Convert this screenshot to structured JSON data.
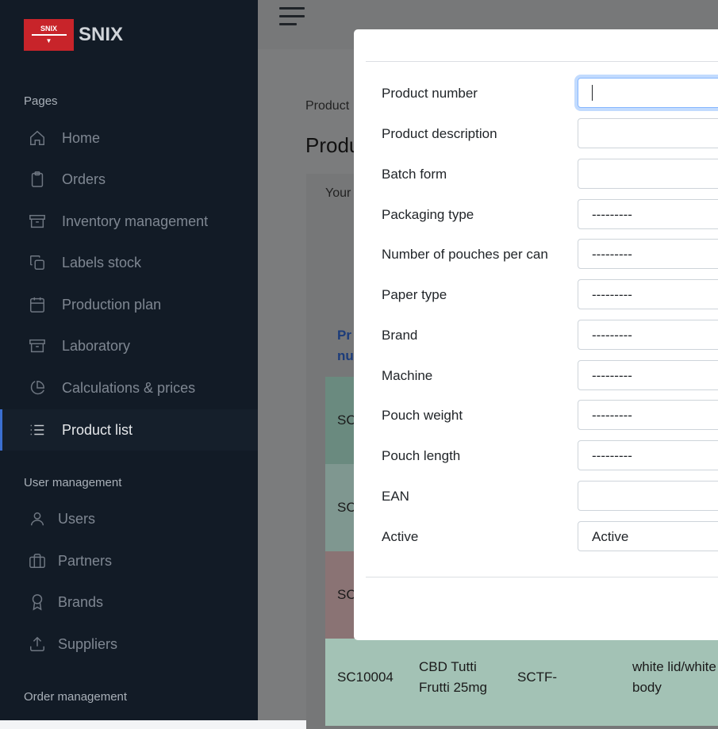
{
  "brand": {
    "logo_text": "SNIX",
    "name": "SNIX"
  },
  "sidebar": {
    "section_pages": "Pages",
    "pages": [
      {
        "label": "Home",
        "icon": "home-icon"
      },
      {
        "label": "Orders",
        "icon": "clipboard-icon"
      },
      {
        "label": "Inventory management",
        "icon": "archive-icon"
      },
      {
        "label": "Labels stock",
        "icon": "copy-icon"
      },
      {
        "label": "Production plan",
        "icon": "calendar-icon"
      },
      {
        "label": "Laboratory",
        "icon": "archive-icon"
      },
      {
        "label": "Calculations & prices",
        "icon": "pie-chart-icon"
      },
      {
        "label": "Product list",
        "icon": "list-icon",
        "active": true
      }
    ],
    "section_users": "User management",
    "users": [
      {
        "label": "Users",
        "icon": "user-icon"
      },
      {
        "label": "Partners",
        "icon": "briefcase-icon"
      },
      {
        "label": "Brands",
        "icon": "award-icon"
      },
      {
        "label": "Suppliers",
        "icon": "upload-icon"
      }
    ],
    "section_orders": "Order management"
  },
  "main": {
    "breadcrumb": "Product",
    "title": "Produ",
    "card_text": "Your",
    "col_header_1": "Pr",
    "col_header_2": "nu",
    "rows": [
      {
        "c1": "SC",
        "c2": "",
        "c3": "",
        "c4": "",
        "color": "#6a8a7f"
      },
      {
        "c1": "SC",
        "c2": "",
        "c3": "",
        "c4": "",
        "color": "#6a8a7f"
      },
      {
        "c1": "SC",
        "c2": "",
        "c3": "",
        "c4": "",
        "color": "#8a6f71"
      },
      {
        "c1": "SC10004",
        "c2a": "CBD Tutti",
        "c2b": "Frutti 25mg",
        "c3": "SCTF-",
        "c4a": "white lid/white",
        "c4b": "body",
        "color": "#a3c2b5"
      }
    ]
  },
  "modal": {
    "fields": [
      {
        "label": "Product number",
        "value": "",
        "focused": true
      },
      {
        "label": "Product description",
        "value": ""
      },
      {
        "label": "Batch form",
        "value": ""
      },
      {
        "label": "Packaging type",
        "value": "---------"
      },
      {
        "label": "Number of pouches per can",
        "value": "---------"
      },
      {
        "label": "Paper type",
        "value": "---------"
      },
      {
        "label": "Brand",
        "value": "---------"
      },
      {
        "label": "Machine",
        "value": "---------"
      },
      {
        "label": "Pouch weight",
        "value": "---------"
      },
      {
        "label": "Pouch length",
        "value": "---------"
      },
      {
        "label": "EAN",
        "value": ""
      },
      {
        "label": "Active",
        "value": "Active"
      }
    ]
  }
}
